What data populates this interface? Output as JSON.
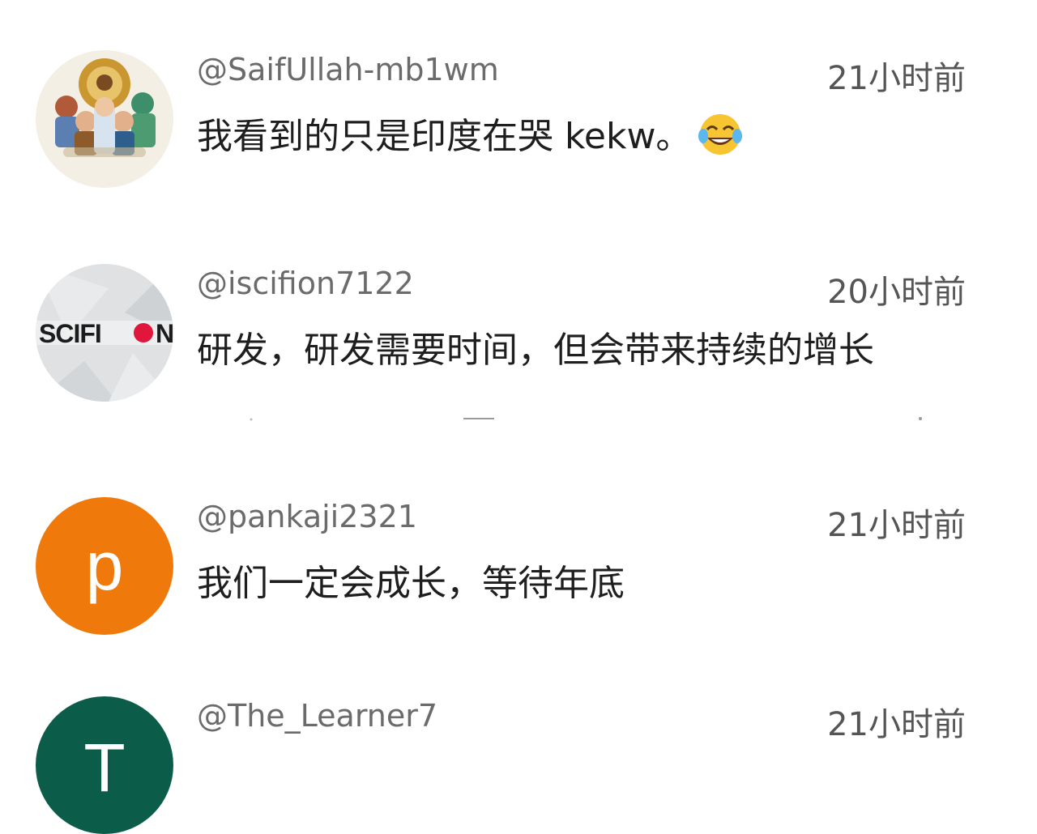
{
  "comments": [
    {
      "author": "@SaifUllah-mb1wm",
      "time": "21小时前",
      "text": "我看到的只是印度在哭 kekw。",
      "emoji": "face-with-tears-of-joy-icon",
      "avatar": {
        "type": "illustration",
        "description_icon": "group-illustration-avatar"
      }
    },
    {
      "author": "@iscifion7122",
      "time": "20小时前",
      "text": "研发，研发需要时间，但会带来持续的增长",
      "avatar": {
        "type": "logo",
        "logo_text": "SCIFION"
      }
    },
    {
      "author": "@pankaji2321",
      "time": "21小时前",
      "text": "我们一定会成长，等待年底",
      "avatar": {
        "type": "letter",
        "letter": "p",
        "color": "#ef7a0b"
      }
    },
    {
      "author": "@The_Learner7",
      "time": "21小时前",
      "text": "",
      "avatar": {
        "type": "letter",
        "letter": "T",
        "color": "#0b5d4a"
      }
    }
  ]
}
